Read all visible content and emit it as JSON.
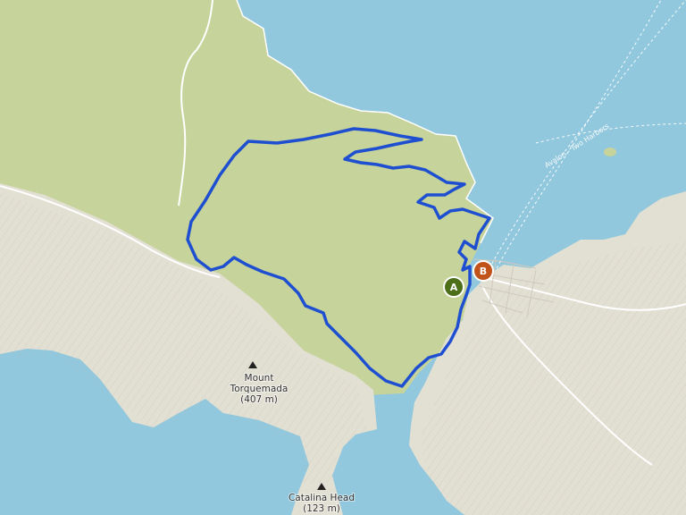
{
  "map": {
    "colors": {
      "water": "#92c8dd",
      "park_land": "#c6d39a",
      "terrain": "#e2dfd3",
      "route": "#1f4fd1",
      "marker_start": "#4d6f1a",
      "marker_end": "#c0531a",
      "ferry_line": "#ffffff"
    },
    "peaks": [
      {
        "name": "Mount Torquemada",
        "line1": "Mount",
        "line2": "Torquemada",
        "elevation": "(407 m)",
        "icon": "peak-triangle-icon"
      },
      {
        "name": "Catalina Head",
        "line1": "Catalina Head",
        "elevation": "(123 m)",
        "icon": "peak-triangle-icon"
      }
    ],
    "ferry_route": {
      "label": "Avalon - Two Harbors"
    },
    "markers": {
      "start": {
        "letter": "A",
        "icon": "route-start-marker-icon"
      },
      "end": {
        "letter": "B",
        "icon": "route-end-marker-icon"
      }
    }
  }
}
